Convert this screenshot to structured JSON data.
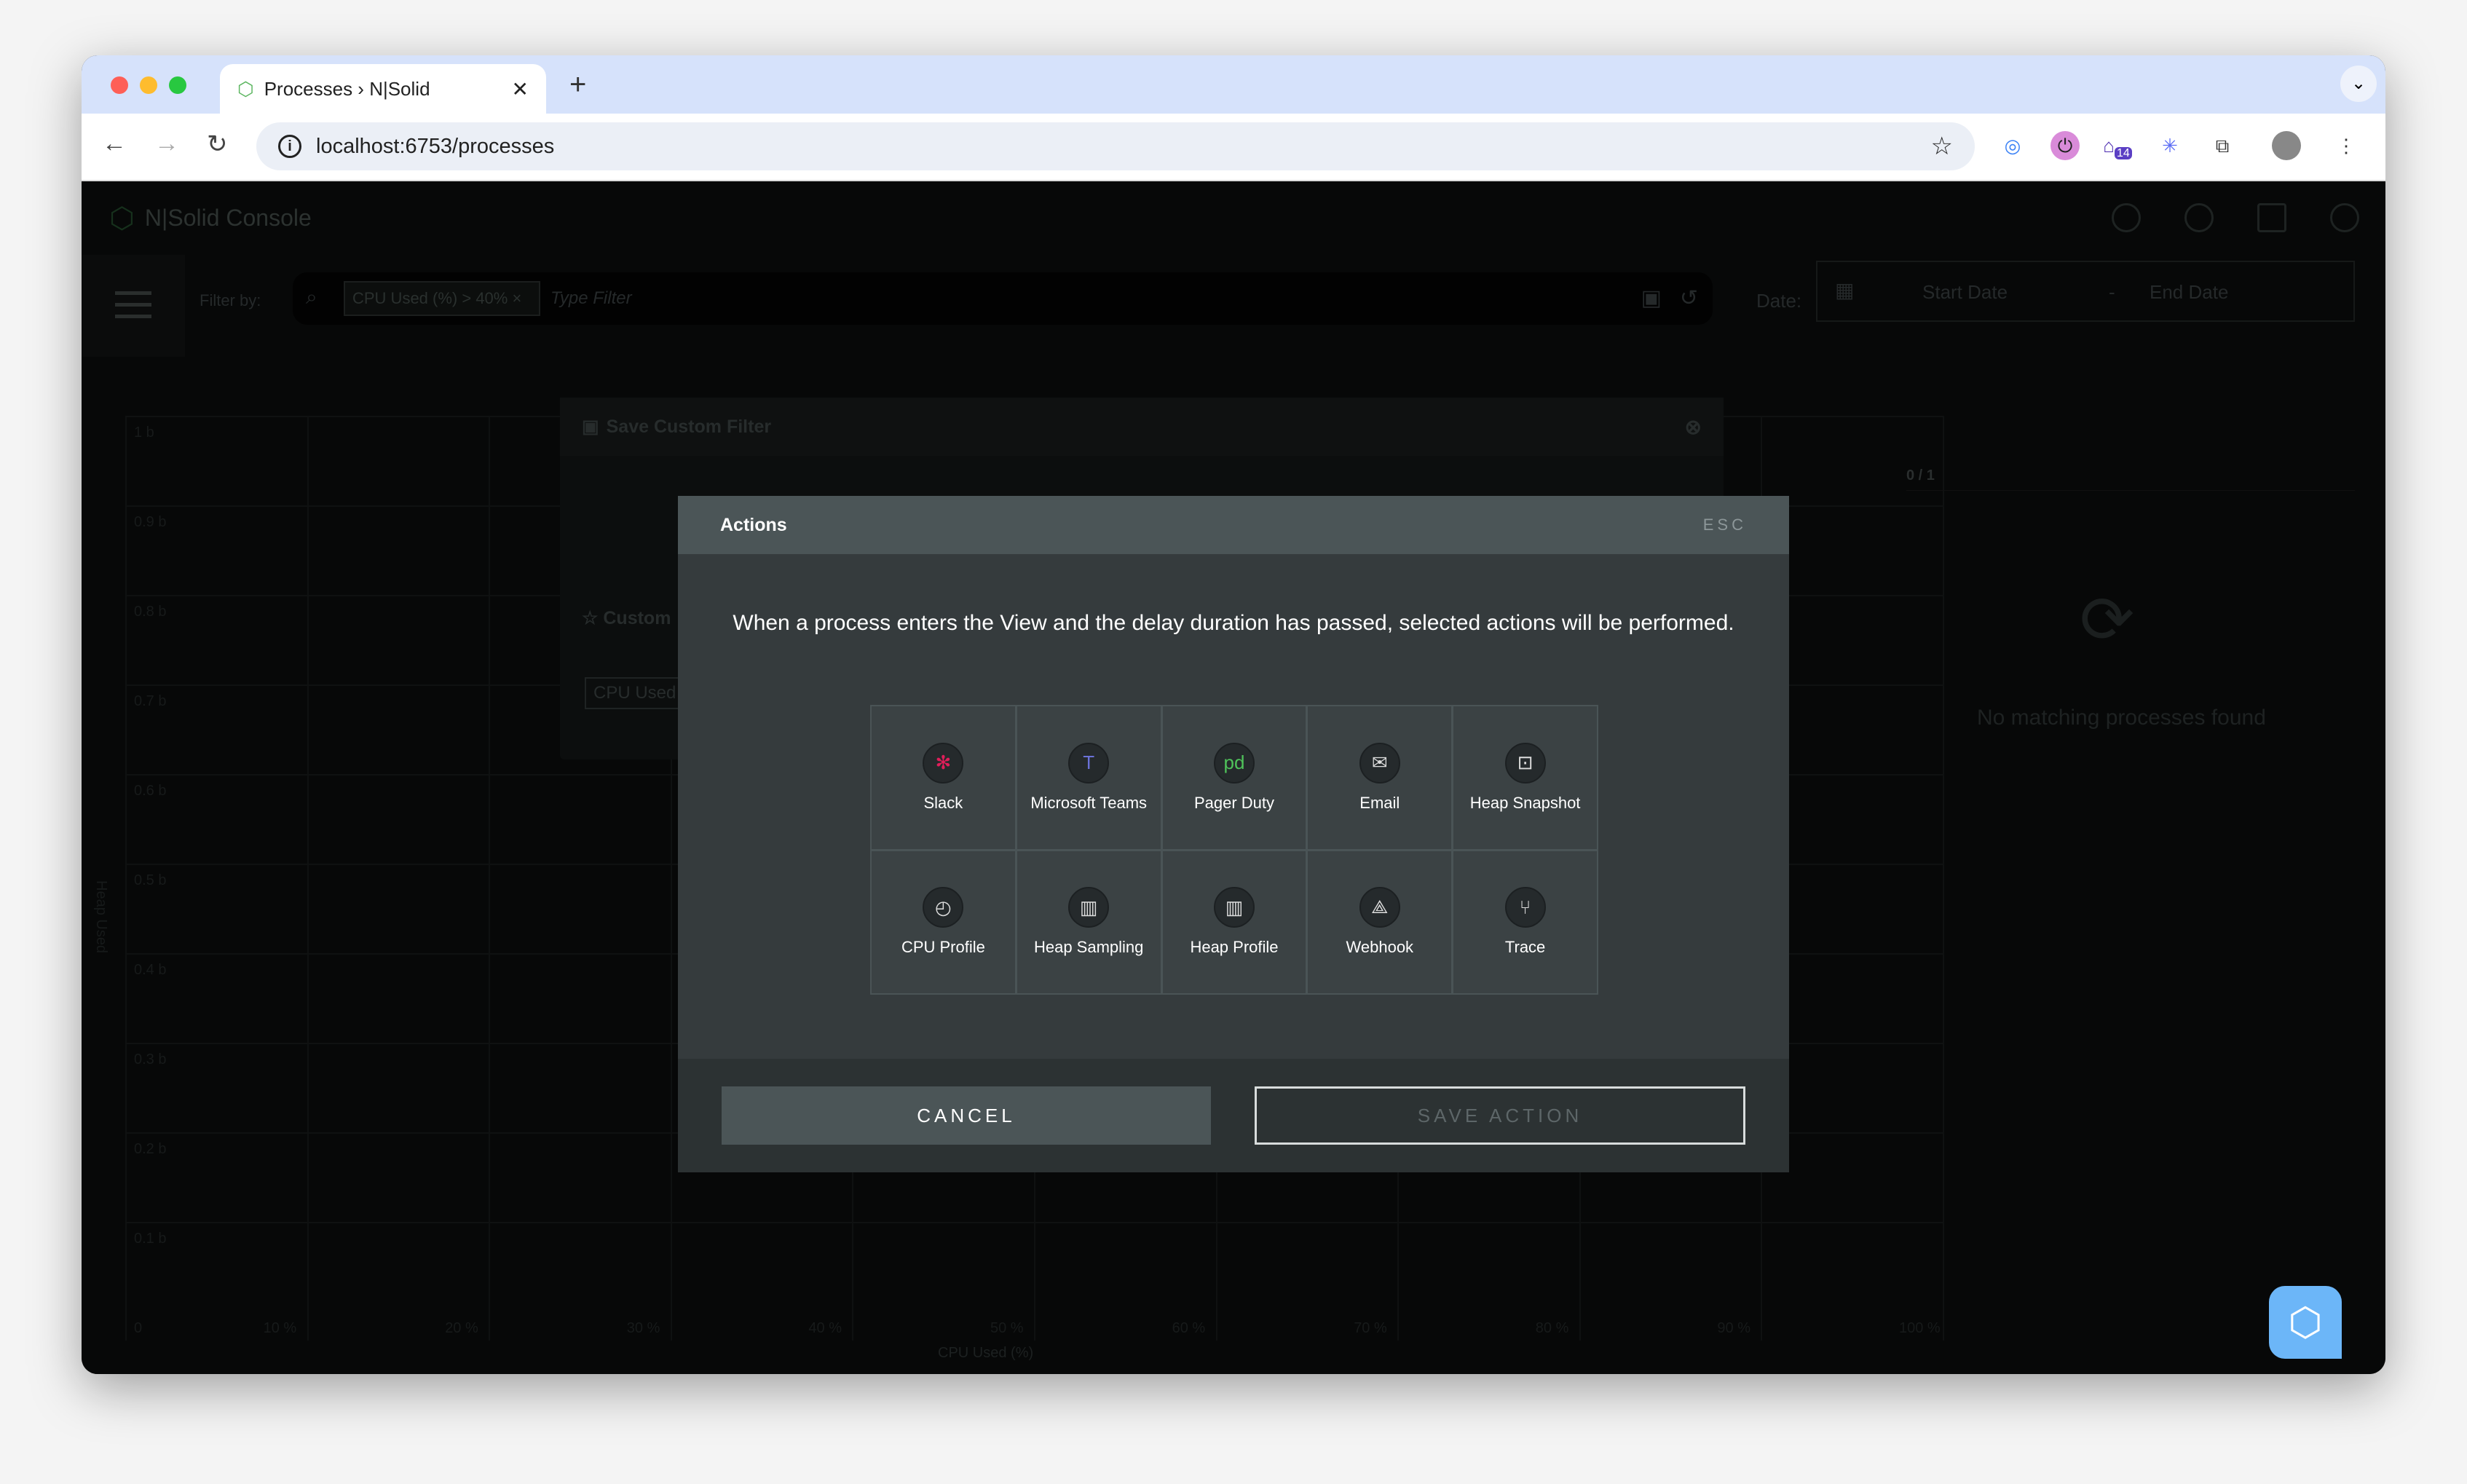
{
  "browser": {
    "tab_title": "Processes › N|Solid",
    "url": "localhost:6753/processes",
    "extension_badge": "14"
  },
  "app": {
    "title": "N|Solid Console",
    "filter": {
      "label": "Filter by:",
      "chip": "CPU Used (%) > 40%",
      "chip_close": "×",
      "placeholder": "Type Filter"
    },
    "date": {
      "label": "Date:",
      "start": "Start Date",
      "separator": "-",
      "end": "End Date"
    },
    "chart": {
      "type": "scatter",
      "ylabel": "Heap Used",
      "xlabel": "CPU Used (%)",
      "yticks": [
        "1 b",
        "0.9 b",
        "0.8 b",
        "0.7 b",
        "0.6 b",
        "0.5 b",
        "0.4 b",
        "0.3 b",
        "0.2 b",
        "0.1 b"
      ],
      "xticks": [
        "0",
        "10 %",
        "20 %",
        "30 %",
        "40 %",
        "50 %",
        "60 %",
        "70 %",
        "80 %",
        "90 %",
        "100 %"
      ]
    },
    "save_filter_panel": {
      "title": "Save Custom Filter",
      "custom_label": "Custom",
      "chip": "CPU Used ("
    },
    "right_panel": {
      "count": "0 / 1",
      "empty": "No matching processes found"
    }
  },
  "modal": {
    "title": "Actions",
    "esc": "ESC",
    "description": "When a process enters the View and the delay duration has passed, selected actions will be performed.",
    "actions": [
      {
        "label": "Slack",
        "icon": "slack-icon"
      },
      {
        "label": "Microsoft Teams",
        "icon": "teams-icon"
      },
      {
        "label": "Pager Duty",
        "icon": "pagerduty-icon"
      },
      {
        "label": "Email",
        "icon": "email-icon"
      },
      {
        "label": "Heap Snapshot",
        "icon": "heap-snapshot-icon"
      },
      {
        "label": "CPU Profile",
        "icon": "cpu-profile-icon"
      },
      {
        "label": "Heap Sampling",
        "icon": "heap-sampling-icon"
      },
      {
        "label": "Heap Profile",
        "icon": "heap-profile-icon"
      },
      {
        "label": "Webhook",
        "icon": "webhook-icon"
      },
      {
        "label": "Trace",
        "icon": "trace-icon"
      }
    ],
    "cancel": "CANCEL",
    "save": "SAVE ACTION"
  }
}
